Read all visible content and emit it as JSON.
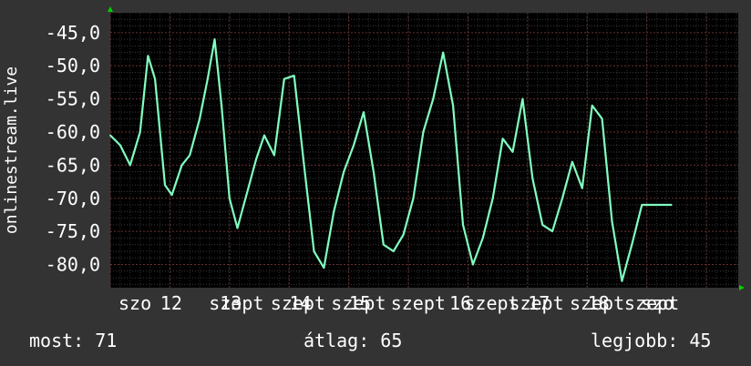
{
  "chart_data": {
    "type": "line",
    "ylabel": "onlinestream.live",
    "ylim": [
      -83.5,
      -42.0
    ],
    "yticks": [
      -45.0,
      -50.0,
      -55.0,
      -60.0,
      -65.0,
      -70.0,
      -75.0,
      -80.0
    ],
    "ytick_labels": [
      "-45,0",
      "-50,0",
      "-55,0",
      "-60,0",
      "-65,0",
      "-70,0",
      "-75,0",
      "-80,0"
    ],
    "xlim": [
      0,
      6.32
    ],
    "xtick_labels": [
      {
        "x": 0.0,
        "label": "szo"
      },
      {
        "x": 0.42,
        "label": "12"
      },
      {
        "x": 0.91,
        "label": "szept"
      },
      {
        "x": 1.02,
        "label": "13"
      },
      {
        "x": 1.53,
        "label": "szept"
      },
      {
        "x": 1.72,
        "label": "14"
      },
      {
        "x": 2.14,
        "label": "szept"
      },
      {
        "x": 2.32,
        "label": "15"
      },
      {
        "x": 2.74,
        "label": "szept"
      },
      {
        "x": 3.33,
        "label": "16"
      },
      {
        "x": 3.48,
        "label": "szept"
      },
      {
        "x": 3.93,
        "label": "szept"
      },
      {
        "x": 4.12,
        "label": "17"
      },
      {
        "x": 4.54,
        "label": "szept"
      },
      {
        "x": 4.72,
        "label": "18"
      },
      {
        "x": 5.09,
        "label": "szept"
      },
      {
        "x": 5.26,
        "label": "szo"
      }
    ],
    "series": [
      {
        "color": "#80ffc0",
        "x": [
          0.0,
          0.1,
          0.2,
          0.3,
          0.38,
          0.45,
          0.55,
          0.62,
          0.72,
          0.8,
          0.9,
          0.98,
          1.05,
          1.12,
          1.2,
          1.28,
          1.38,
          1.47,
          1.55,
          1.65,
          1.75,
          1.85,
          1.95,
          2.05,
          2.15,
          2.25,
          2.35,
          2.45,
          2.55,
          2.65,
          2.75,
          2.85,
          2.95,
          3.05,
          3.15,
          3.25,
          3.35,
          3.45,
          3.55,
          3.65,
          3.75,
          3.85,
          3.95,
          4.05,
          4.15,
          4.25,
          4.35,
          4.45,
          4.55,
          4.65,
          4.75,
          4.85,
          4.95,
          5.05,
          5.15,
          5.25,
          5.35,
          5.45,
          5.55,
          5.65
        ],
        "y": [
          -60.5,
          -62.0,
          -65.0,
          -60.0,
          -48.5,
          -52.0,
          -68.0,
          -69.5,
          -65.0,
          -63.5,
          -58.0,
          -52.0,
          -46.0,
          -56.0,
          -70.0,
          -74.5,
          -69.0,
          -64.0,
          -60.5,
          -63.5,
          -52.0,
          -51.5,
          -65.0,
          -78.0,
          -80.5,
          -72.0,
          -66.0,
          -62.0,
          -57.0,
          -66.0,
          -77.0,
          -78.0,
          -75.5,
          -70.0,
          -60.0,
          -55.0,
          -48.0,
          -56.0,
          -74.0,
          -80.0,
          -76.0,
          -70.0,
          -61.0,
          -63.0,
          -55.0,
          -67.0,
          -74.0,
          -75.0,
          -70.0,
          -64.5,
          -68.5,
          -56.0,
          -58.0,
          -73.5,
          -82.5,
          -77.0,
          -71.0,
          -71.0,
          -71.0,
          -71.0
        ]
      }
    ]
  },
  "stats": {
    "current": "most: 71",
    "average": "átlag: 65",
    "best": "legjobb: 45"
  }
}
